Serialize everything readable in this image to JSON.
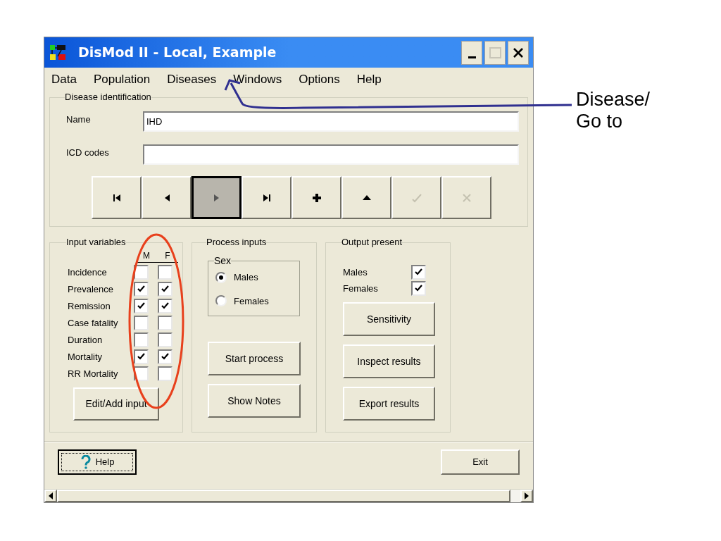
{
  "window": {
    "title": "DisMod II - Local, Example"
  },
  "menu": [
    {
      "label": "Data"
    },
    {
      "label": "Population"
    },
    {
      "label": "Diseases"
    },
    {
      "label": "Windows"
    },
    {
      "label": "Options"
    },
    {
      "label": "Help"
    }
  ],
  "disease_identification": {
    "title": "Disease identification",
    "fields": [
      {
        "label": "Name",
        "value": "IHD"
      },
      {
        "label": "ICD codes"
      }
    ]
  },
  "nav_buttons": [
    {
      "kind": "first",
      "selected": false,
      "disabled": false
    },
    {
      "kind": "prev",
      "selected": false,
      "disabled": false
    },
    {
      "kind": "next",
      "selected": true,
      "disabled": false
    },
    {
      "kind": "last",
      "selected": false,
      "disabled": false
    },
    {
      "kind": "add",
      "selected": false,
      "disabled": false
    },
    {
      "kind": "up",
      "selected": false,
      "disabled": false
    },
    {
      "kind": "confirm",
      "selected": false,
      "disabled": true
    },
    {
      "kind": "cancel",
      "selected": false,
      "disabled": true
    }
  ],
  "input_variables": {
    "title": "Input variables",
    "column_1": "M",
    "column_2": "F",
    "rows": [
      {
        "label": "Incidence",
        "male": false,
        "female": false
      },
      {
        "label": "Prevalence",
        "male": true,
        "female": true
      },
      {
        "label": "Remission",
        "male": true,
        "female": true
      },
      {
        "label": "Case fatality",
        "male": false,
        "female": false
      },
      {
        "label": "Duration",
        "male": false,
        "female": false
      },
      {
        "label": "Mortality",
        "male": true,
        "female": true
      },
      {
        "label": "RR Mortality",
        "male": false,
        "female": false
      }
    ],
    "button": "Edit/Add input"
  },
  "process_inputs": {
    "title": "Process inputs",
    "sex": {
      "title": "Sex",
      "options": [
        {
          "label": "Males",
          "selected": true
        },
        {
          "label": "Females",
          "selected": false
        }
      ]
    },
    "buttons": [
      "Start process",
      "Show Notes"
    ]
  },
  "output_present": {
    "title": "Output present",
    "items": [
      {
        "label": "Males",
        "checked": true
      },
      {
        "label": "Females",
        "checked": true
      }
    ],
    "buttons": [
      "Sensitivity",
      "Inspect results",
      "Export results"
    ]
  },
  "footer_buttons": [
    {
      "label": "Help",
      "kind": "help",
      "focused": true
    },
    {
      "label": "Exit",
      "kind": "plain",
      "focused": false
    }
  ],
  "annotation": {
    "text": "Disease/\nGo to"
  }
}
